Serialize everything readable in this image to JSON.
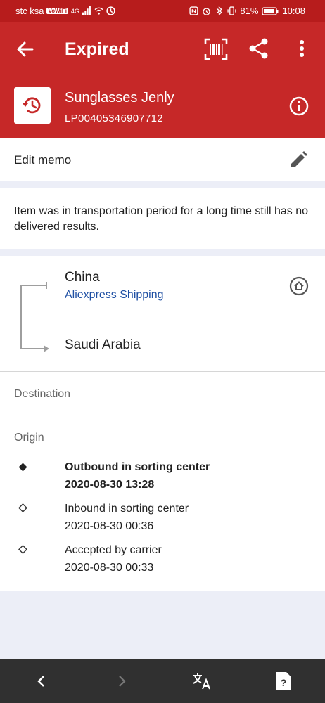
{
  "status_bar": {
    "carrier": "stc ksa",
    "wifi_badge": "VoWiFi",
    "network": "4G",
    "battery": "81%",
    "time": "10:08"
  },
  "app_bar": {
    "title": "Expired",
    "item_name": "Sunglasses Jenly",
    "tracking_number": "LP00405346907712",
    "icons": [
      "arrow-back-icon",
      "barcode-scan-icon",
      "share-icon",
      "more-vert-icon",
      "history-icon",
      "info-icon"
    ]
  },
  "memo": {
    "label": "Edit memo"
  },
  "status_message": "Item was in transportation period for a long time still has no delivered results.",
  "route": {
    "origin": "China",
    "carrier": "Aliexpress Shipping",
    "destination": "Saudi Arabia"
  },
  "sections": {
    "destination_label": "Destination",
    "origin_label": "Origin"
  },
  "events": [
    {
      "title": "Outbound in sorting center",
      "time": "2020-08-30 13:28"
    },
    {
      "title": "Inbound in sorting center",
      "time": "2020-08-30 00:36"
    },
    {
      "title": "Accepted by carrier",
      "time": "2020-08-30 00:33"
    }
  ],
  "colors": {
    "header": "#c62828",
    "status_bar": "#b71c1c",
    "link": "#1e4fa3",
    "nav_bar": "#303030"
  }
}
